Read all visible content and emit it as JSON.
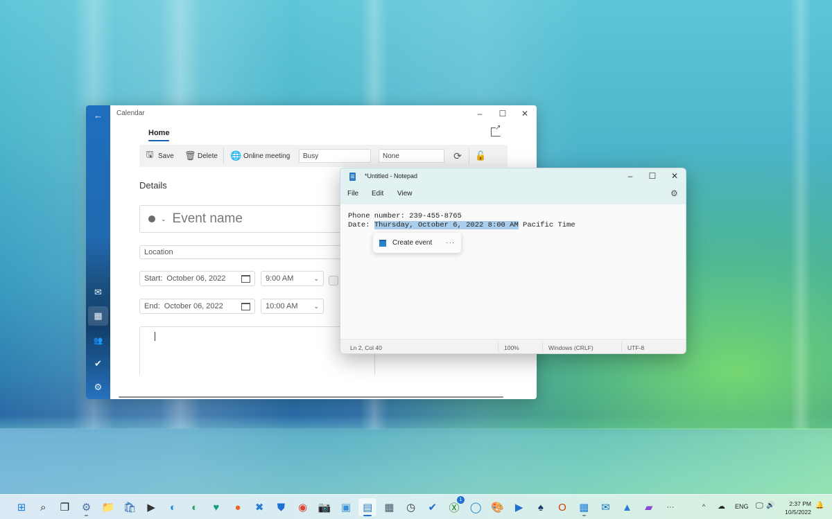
{
  "calendar_window": {
    "title": "Calendar",
    "controls": {
      "minimize": "–",
      "maximize": "☐",
      "close": "✕"
    },
    "back_icon": "←",
    "rail": [
      {
        "name": "mail",
        "glyph": "✉"
      },
      {
        "name": "calendar",
        "glyph": "▦",
        "active": true
      },
      {
        "name": "people",
        "glyph": "👥"
      },
      {
        "name": "todo",
        "glyph": "✔"
      },
      {
        "name": "settings",
        "glyph": "⚙"
      }
    ],
    "tab": "Home",
    "toolbar": {
      "save": "Save",
      "delete": "Delete",
      "online_meeting": "Online meeting",
      "show_as": "Busy",
      "reminder": "None"
    },
    "details_heading": "Details",
    "event_name_placeholder": "Event name",
    "location_placeholder": "Location",
    "start": {
      "label": "Start:",
      "date": "October 06, 2022",
      "time": "9:00 AM"
    },
    "end": {
      "label": "End:",
      "date": "October 06, 2022",
      "time": "10:00 AM"
    }
  },
  "notepad_window": {
    "title": "*Untitled - Notepad",
    "controls": {
      "minimize": "–",
      "maximize": "☐",
      "close": "✕"
    },
    "menu": [
      "File",
      "Edit",
      "View"
    ],
    "text": {
      "line1": "Phone number: 239-455-8765",
      "line2_prefix": "Date: ",
      "line2_selected": "Thursday, October 6, 2022 8:00 AM",
      "line2_suffix": " Pacific Time"
    },
    "popup": {
      "action": "Create event",
      "more": "···"
    },
    "status": {
      "position": "Ln 2, Col 40",
      "zoom": "100%",
      "line_ending": "Windows (CRLF)",
      "encoding": "UTF-8"
    }
  },
  "taskbar": {
    "apps": [
      {
        "name": "start",
        "glyph": "⊞",
        "color": "#1e7fd6"
      },
      {
        "name": "search",
        "glyph": "⌕",
        "color": "#222"
      },
      {
        "name": "task-view",
        "glyph": "❐",
        "color": "#222"
      },
      {
        "name": "settings",
        "glyph": "⚙",
        "color": "#4a6fa5"
      },
      {
        "name": "file-explorer",
        "glyph": "📁",
        "color": "#e8b530"
      },
      {
        "name": "store",
        "glyph": "🛍",
        "color": "#1f5fa8"
      },
      {
        "name": "terminal",
        "glyph": "▶",
        "color": "#333"
      },
      {
        "name": "edge",
        "glyph": "◐",
        "color": "#1b8ad6"
      },
      {
        "name": "edge-canary",
        "glyph": "◐",
        "color": "#2a9d6a"
      },
      {
        "name": "health",
        "glyph": "♥",
        "color": "#18a085"
      },
      {
        "name": "firefox",
        "glyph": "●",
        "color": "#e8642c"
      },
      {
        "name": "app-x",
        "glyph": "✖",
        "color": "#2a7bd6"
      },
      {
        "name": "defender",
        "glyph": "⛊",
        "color": "#1e6fd0"
      },
      {
        "name": "chrome",
        "glyph": "◉",
        "color": "#db4437"
      },
      {
        "name": "camera",
        "glyph": "📷",
        "color": "#555"
      },
      {
        "name": "photos-legacy",
        "glyph": "▣",
        "color": "#3a8fd6"
      },
      {
        "name": "notepad",
        "glyph": "▤",
        "color": "#2f7bc4",
        "active": true
      },
      {
        "name": "calculator",
        "glyph": "▦",
        "color": "#4a5a6a"
      },
      {
        "name": "clock",
        "glyph": "◷",
        "color": "#333"
      },
      {
        "name": "todo",
        "glyph": "✔",
        "color": "#2564cf"
      },
      {
        "name": "xbox",
        "glyph": "Ⓧ",
        "color": "#107c10",
        "badge": "1"
      },
      {
        "name": "tips",
        "glyph": "◯",
        "color": "#1e7fd6"
      },
      {
        "name": "paint",
        "glyph": "🎨",
        "color": "#3a8fd6"
      },
      {
        "name": "media-player",
        "glyph": "▶",
        "color": "#1e6fd0"
      },
      {
        "name": "solitaire",
        "glyph": "♠",
        "color": "#1e3a6a"
      },
      {
        "name": "office",
        "glyph": "O",
        "color": "#d83b01"
      },
      {
        "name": "calendar",
        "glyph": "▦",
        "color": "#1e7fd6"
      },
      {
        "name": "mail",
        "glyph": "✉",
        "color": "#1273c4"
      },
      {
        "name": "photos",
        "glyph": "▲",
        "color": "#2a7bd6"
      },
      {
        "name": "clipchamp",
        "glyph": "▰",
        "color": "#8a4ad6"
      },
      {
        "name": "more",
        "glyph": "···",
        "color": "#333"
      }
    ],
    "tray": {
      "chevron": "^",
      "onedrive": "☁",
      "language": "ENG",
      "network": "🖵",
      "volume": "🔊",
      "time": "2:37 PM",
      "date": "10/5/2022",
      "notification": "🔔"
    }
  }
}
